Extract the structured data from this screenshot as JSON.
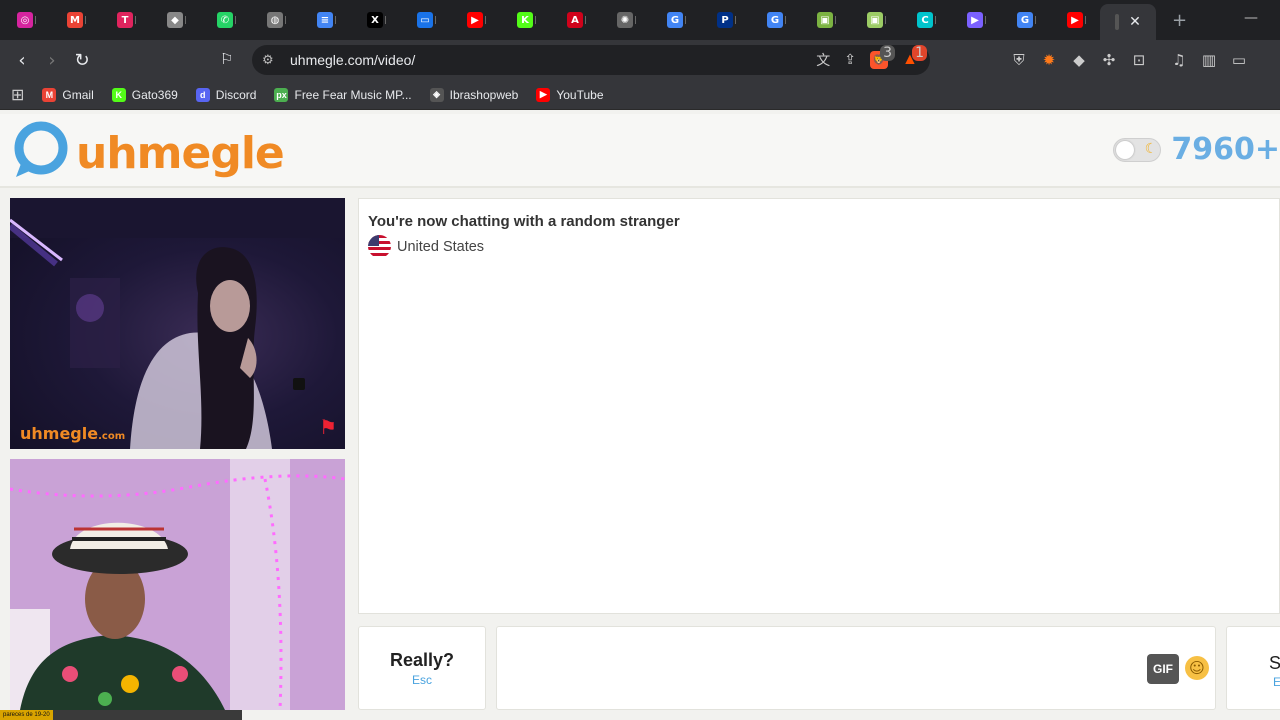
{
  "browser": {
    "tabs": [
      {
        "icon": "instagram-icon",
        "color": "#d6249f",
        "glyph": "◎"
      },
      {
        "icon": "gmail-icon",
        "color": "#ea4335",
        "glyph": "M"
      },
      {
        "icon": "tab-app-icon",
        "color": "#e0245e",
        "glyph": "T"
      },
      {
        "icon": "diamond-icon",
        "color": "#888888",
        "glyph": "◆"
      },
      {
        "icon": "whatsapp-icon",
        "color": "#25d366",
        "glyph": "✆"
      },
      {
        "icon": "globe-icon",
        "color": "#777777",
        "glyph": "◍"
      },
      {
        "icon": "docs-icon",
        "color": "#4285f4",
        "glyph": "≡"
      },
      {
        "icon": "x-icon",
        "color": "#000000",
        "glyph": "X"
      },
      {
        "icon": "screen-icon",
        "color": "#1a73e8",
        "glyph": "▭"
      },
      {
        "icon": "youtube-icon",
        "color": "#ff0000",
        "glyph": "▶"
      },
      {
        "icon": "kick-icon",
        "color": "#53fc18",
        "glyph": "K"
      },
      {
        "icon": "a-icon",
        "color": "#d0021b",
        "glyph": "A"
      },
      {
        "icon": "openai-icon",
        "color": "#666666",
        "glyph": "✺"
      },
      {
        "icon": "google-icon",
        "color": "#4285f4",
        "glyph": "G"
      },
      {
        "icon": "paypal-icon",
        "color": "#003087",
        "glyph": "P"
      },
      {
        "icon": "google-icon",
        "color": "#4285f4",
        "glyph": "G"
      },
      {
        "icon": "ext-icon",
        "color": "#7cb342",
        "glyph": "▣"
      },
      {
        "icon": "ext-icon",
        "color": "#9ccc65",
        "glyph": "▣"
      },
      {
        "icon": "canva-icon",
        "color": "#00c4cc",
        "glyph": "C"
      },
      {
        "icon": "video-icon",
        "color": "#7b61ff",
        "glyph": "▶"
      },
      {
        "icon": "google-icon",
        "color": "#4285f4",
        "glyph": "G"
      },
      {
        "icon": "youtube-icon",
        "color": "#ff0000",
        "glyph": "▶"
      }
    ],
    "url": "uhmegle.com/video/",
    "brave_shield_badge": "3",
    "rewards_badge": "1",
    "bookmarks": [
      {
        "label": "Gmail",
        "icon": "gmail-icon",
        "color": "#ea4335",
        "glyph": "M"
      },
      {
        "label": "Gato369",
        "icon": "kick-icon",
        "color": "#53fc18",
        "glyph": "K"
      },
      {
        "label": "Discord",
        "icon": "discord-icon",
        "color": "#5865f2",
        "glyph": "d"
      },
      {
        "label": "Free Fear Music MP...",
        "icon": "px-icon",
        "color": "#4caf50",
        "glyph": "px"
      },
      {
        "label": "Ibrashopweb",
        "icon": "shop-icon",
        "color": "#555555",
        "glyph": "◈"
      },
      {
        "label": "YouTube",
        "icon": "youtube-icon",
        "color": "#ff0000",
        "glyph": "▶"
      }
    ]
  },
  "site": {
    "logo_text": "uhmegle",
    "online_count": "7960+",
    "accent": "#f08a24",
    "blue": "#6aaee3"
  },
  "video": {
    "watermark": "uhmegle",
    "watermark_suffix": ".com"
  },
  "chat": {
    "status": "You're now chatting with a random stranger",
    "country": "United States"
  },
  "controls": {
    "stop_label": "Really?",
    "stop_key": "Esc",
    "gif_label": "GIF",
    "send_label": "S",
    "send_key": "E"
  },
  "overlay": {
    "tag": "pareces de 19-20",
    "text": ""
  }
}
